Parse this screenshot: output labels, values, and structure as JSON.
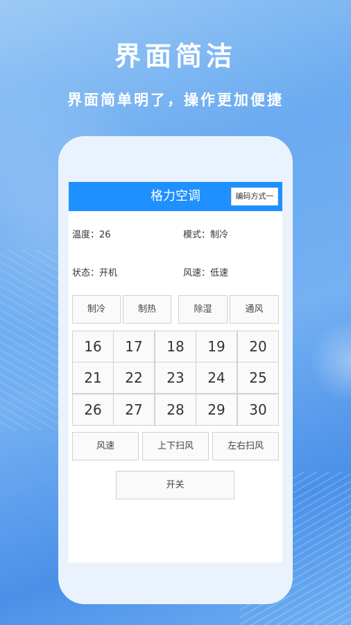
{
  "promo": {
    "title": "界面简洁",
    "subtitle": "界面简单明了，操作更加便捷"
  },
  "app": {
    "header_title": "格力空调",
    "encoding_button": "编码方式一",
    "status": {
      "temperature_label": "温度：",
      "temperature_value": "26",
      "mode_label": "模式：",
      "mode_value": "制冷",
      "state_label": "状态：",
      "state_value": "开机",
      "fan_label": "风速：",
      "fan_value": "低速"
    },
    "mode_buttons": [
      "制冷",
      "制热",
      "除湿",
      "通风"
    ],
    "temperatures": [
      "16",
      "17",
      "18",
      "19",
      "20",
      "21",
      "22",
      "23",
      "24",
      "25",
      "26",
      "27",
      "28",
      "29",
      "30"
    ],
    "function_buttons": [
      "风速",
      "上下扫风",
      "左右扫风"
    ],
    "power_button": "开关"
  },
  "colors": {
    "header_blue": "#1e90ff",
    "button_border": "#d4d0cc"
  }
}
